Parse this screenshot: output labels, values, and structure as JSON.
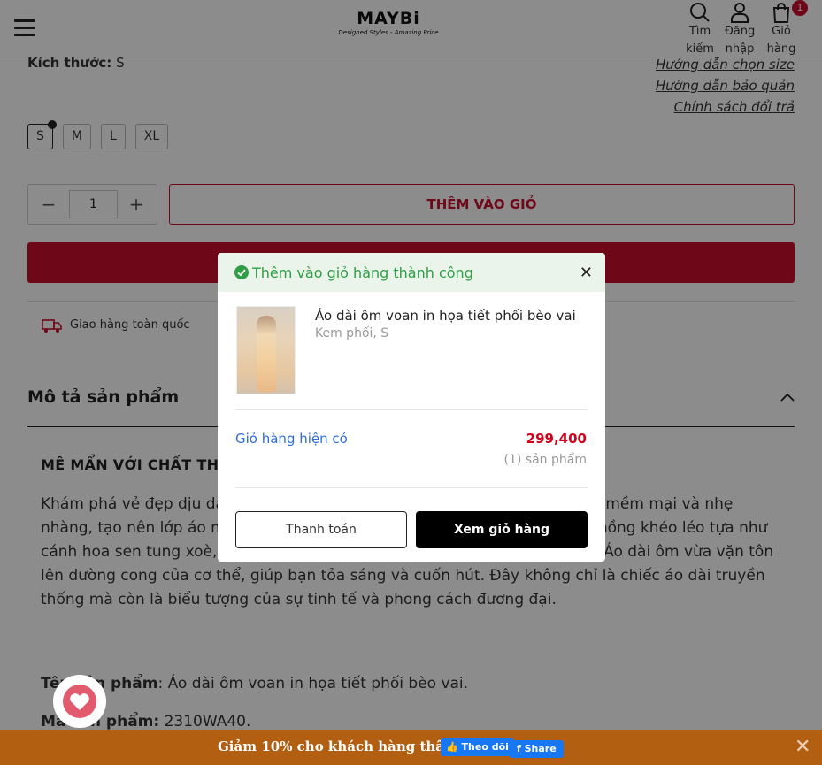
{
  "header": {
    "logo": "MAYBi",
    "tagline": "Designed Styles - Amazing Price",
    "search_label": "Tìm kiếm",
    "login_label": "Đăng nhập",
    "cart_label": "Giỏ hàng",
    "cart_count": "1"
  },
  "product": {
    "size_label": "Kích thước:",
    "size_value": "S",
    "links": [
      "Hướng dẫn chọn size",
      "Hướng dẫn bảo quản",
      "Chính sách đổi trả"
    ],
    "sizes": [
      "S",
      "M",
      "L",
      "XL"
    ],
    "selected_size": "S",
    "quantity": "1",
    "add_to_cart": "THÊM VÀO GIỎ",
    "shipping": "Giao hàng toàn quốc"
  },
  "description": {
    "heading": "Mô tả sản phẩm",
    "title": "MÊ MẨN VỚI CHẤT THO",
    "body": "Khám phá vẻ đẹp dịu dà ư kết hợp tuyệt vời giữa sự truyền thống và nét đ mềm mại và nhẹ nhàng, tạo nên lớp áo m cầu vai áo được mây bồng, những nếp gấp xếp chồng khéo léo tựa như cánh hoa sen tung xoè, nở rộ nhẹ nhàng che đi các khuyết điểm cánh tay. Áo dài ôm vừa vặn tôn lên đường cong của cơ thể, giúp bạn tỏa sáng và cuốn hút. Đây không chỉ là chiếc áo dài truyền thống mà còn là biểu tượng của sự tinh tế và phong cách đương đại.",
    "name_label": "Tên sản phẩm",
    "name_value": ": Áo dài ôm voan in họa tiết phối bèo vai.",
    "code_label": "Mã sản phẩm:",
    "code_value": " 2310WA40."
  },
  "modal": {
    "message": "Thêm vào giỏ hàng thành công",
    "product_name": "Áo dài ôm voan in họa tiết phối bèo vai",
    "variant": "Kem phối, S",
    "cart_now_label": "Giỏ hàng hiện có",
    "total": "299,400",
    "item_count": "(1) sản phẩm",
    "checkout_button": "Thanh toán",
    "view_cart_button": "Xem giỏ hàng"
  },
  "promo": {
    "text": "Giảm 10% cho khách hàng thân thiết",
    "follow": "Theo dõi",
    "share": "Share"
  },
  "colors": {
    "accent": "#c8102e",
    "success": "#2e9e44",
    "link": "#2f6fd6",
    "promo_bar": "#b35f12"
  }
}
